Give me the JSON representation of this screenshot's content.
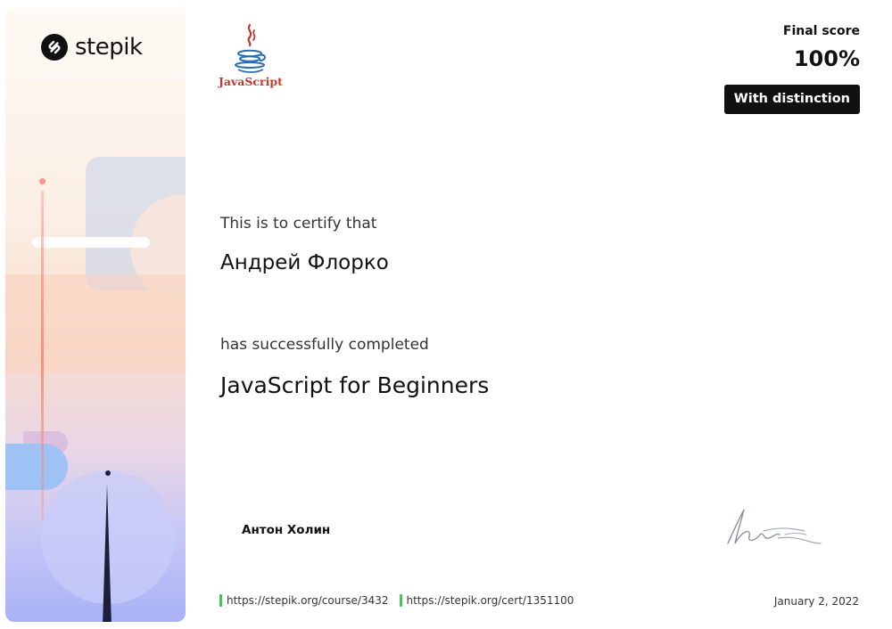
{
  "brand": {
    "name": "stepik",
    "icon": "stepik-logo-icon"
  },
  "course_logo": {
    "icon": "java-cup-icon",
    "label": "JavaScript"
  },
  "score": {
    "label": "Final score",
    "value": "100%",
    "badge": "With distinction"
  },
  "certificate": {
    "certify_text": "This is to certify that",
    "recipient": "Андрей Флорко",
    "completed_text": "has successfully completed",
    "course_title": "JavaScript for Beginners"
  },
  "instructor": {
    "name": "Антон Холин"
  },
  "footer": {
    "course_url": "https://stepik.org/course/3432",
    "cert_url": "https://stepik.org/cert/1351100",
    "date": "January 2, 2022"
  },
  "colors": {
    "accent_green": "#46c35a",
    "badge_bg": "#111111",
    "logo_red": "#c0392b",
    "logo_blue": "#2a6db3"
  }
}
